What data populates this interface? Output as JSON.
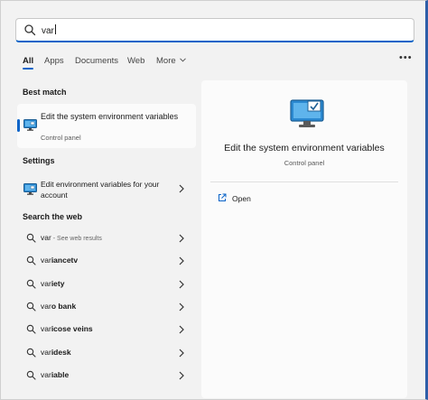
{
  "search": {
    "query": "var"
  },
  "tabs": [
    {
      "label": "All"
    },
    {
      "label": "Apps"
    },
    {
      "label": "Documents"
    },
    {
      "label": "Web"
    },
    {
      "label": "More"
    }
  ],
  "more_options": "•••",
  "sections": {
    "best_match": "Best match",
    "settings": "Settings",
    "web": "Search the web"
  },
  "best_match": {
    "title_pre": "Edit the system environment ",
    "title_bold": "var",
    "title_post": "iables",
    "subtitle": "Control panel"
  },
  "settings_item": {
    "label_pre": "Edit environment ",
    "label_bold": "var",
    "label_post": "iables for your account"
  },
  "web_results": [
    {
      "prefix": "var",
      "bold": "",
      "hint": " - See web results"
    },
    {
      "prefix": "var",
      "bold": "iancetv",
      "hint": ""
    },
    {
      "prefix": "var",
      "bold": "iety",
      "hint": ""
    },
    {
      "prefix": "var",
      "bold": "o bank",
      "hint": ""
    },
    {
      "prefix": "var",
      "bold": "icose veins",
      "hint": ""
    },
    {
      "prefix": "var",
      "bold": "idesk",
      "hint": ""
    },
    {
      "prefix": "var",
      "bold": "iable",
      "hint": ""
    }
  ],
  "detail": {
    "title": "Edit the system environment variables",
    "subtitle": "Control panel",
    "open_label": "Open"
  },
  "colors": {
    "accent": "#0a64c8",
    "panel": "#fbfbfb",
    "background": "#f2f2f2"
  }
}
